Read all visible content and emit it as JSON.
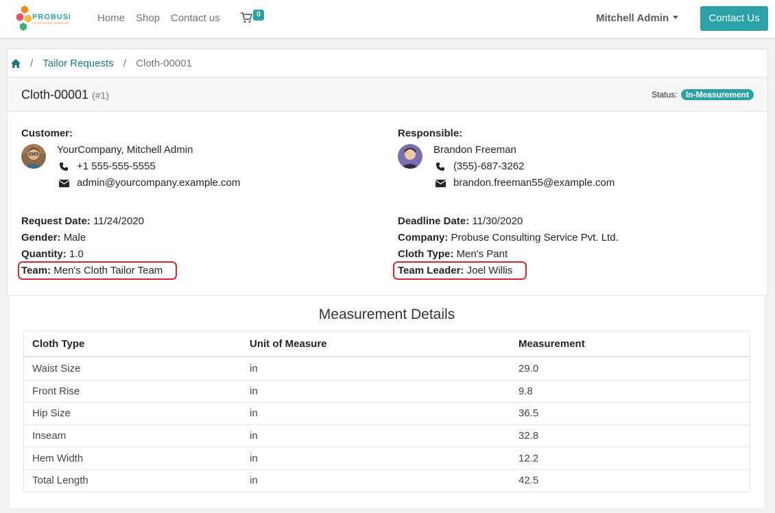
{
  "brand": {
    "name": "PROBUSE",
    "tagline": "PROFESSIONAL BUSINESS"
  },
  "nav": {
    "items": [
      {
        "label": "Home"
      },
      {
        "label": "Shop"
      },
      {
        "label": "Contact us"
      }
    ],
    "cart_count": "0",
    "user": "Mitchell Admin",
    "contact_button": "Contact Us"
  },
  "breadcrumb": {
    "root_icon": "home-icon",
    "items": [
      "Tailor Requests",
      "Cloth-00001"
    ]
  },
  "header": {
    "title": "Cloth-00001",
    "id": "(#1)",
    "status_label": "Status:",
    "status": "In-Measurement"
  },
  "customer": {
    "label": "Customer:",
    "name": "YourCompany, Mitchell Admin",
    "phone": "+1 555-555-5555",
    "email": "admin@yourcompany.example.com"
  },
  "responsible": {
    "label": "Responsible:",
    "name": "Brandon Freeman",
    "phone": "(355)-687-3262",
    "email": "brandon.freeman55@example.com"
  },
  "details_left": [
    {
      "label": "Request Date:",
      "value": "11/24/2020"
    },
    {
      "label": "Gender:",
      "value": "Male"
    },
    {
      "label": "Quantity:",
      "value": "1.0"
    },
    {
      "label": "Team:",
      "value": "Men's Cloth Tailor Team"
    }
  ],
  "details_right": [
    {
      "label": "Deadline Date:",
      "value": "11/30/2020"
    },
    {
      "label": "Company:",
      "value": "Probuse Consulting Service Pvt. Ltd."
    },
    {
      "label": "Cloth Type:",
      "value": "Men's Pant"
    },
    {
      "label": "Team Leader:",
      "value": "Joel Willis"
    }
  ],
  "measurement": {
    "title": "Measurement Details",
    "columns": [
      "Cloth Type",
      "Unit of Measure",
      "Measurement"
    ],
    "rows": [
      [
        "Waist Size",
        "in",
        "29.0"
      ],
      [
        "Front Rise",
        "in",
        "9.8"
      ],
      [
        "Hip Size",
        "in",
        "36.5"
      ],
      [
        "Inseam",
        "in",
        "32.8"
      ],
      [
        "Hem Width",
        "in",
        "12.2"
      ],
      [
        "Total Length",
        "in",
        "42.5"
      ]
    ]
  },
  "colors": {
    "accent": "#2ba3a6",
    "highlight": "#d9232e"
  }
}
